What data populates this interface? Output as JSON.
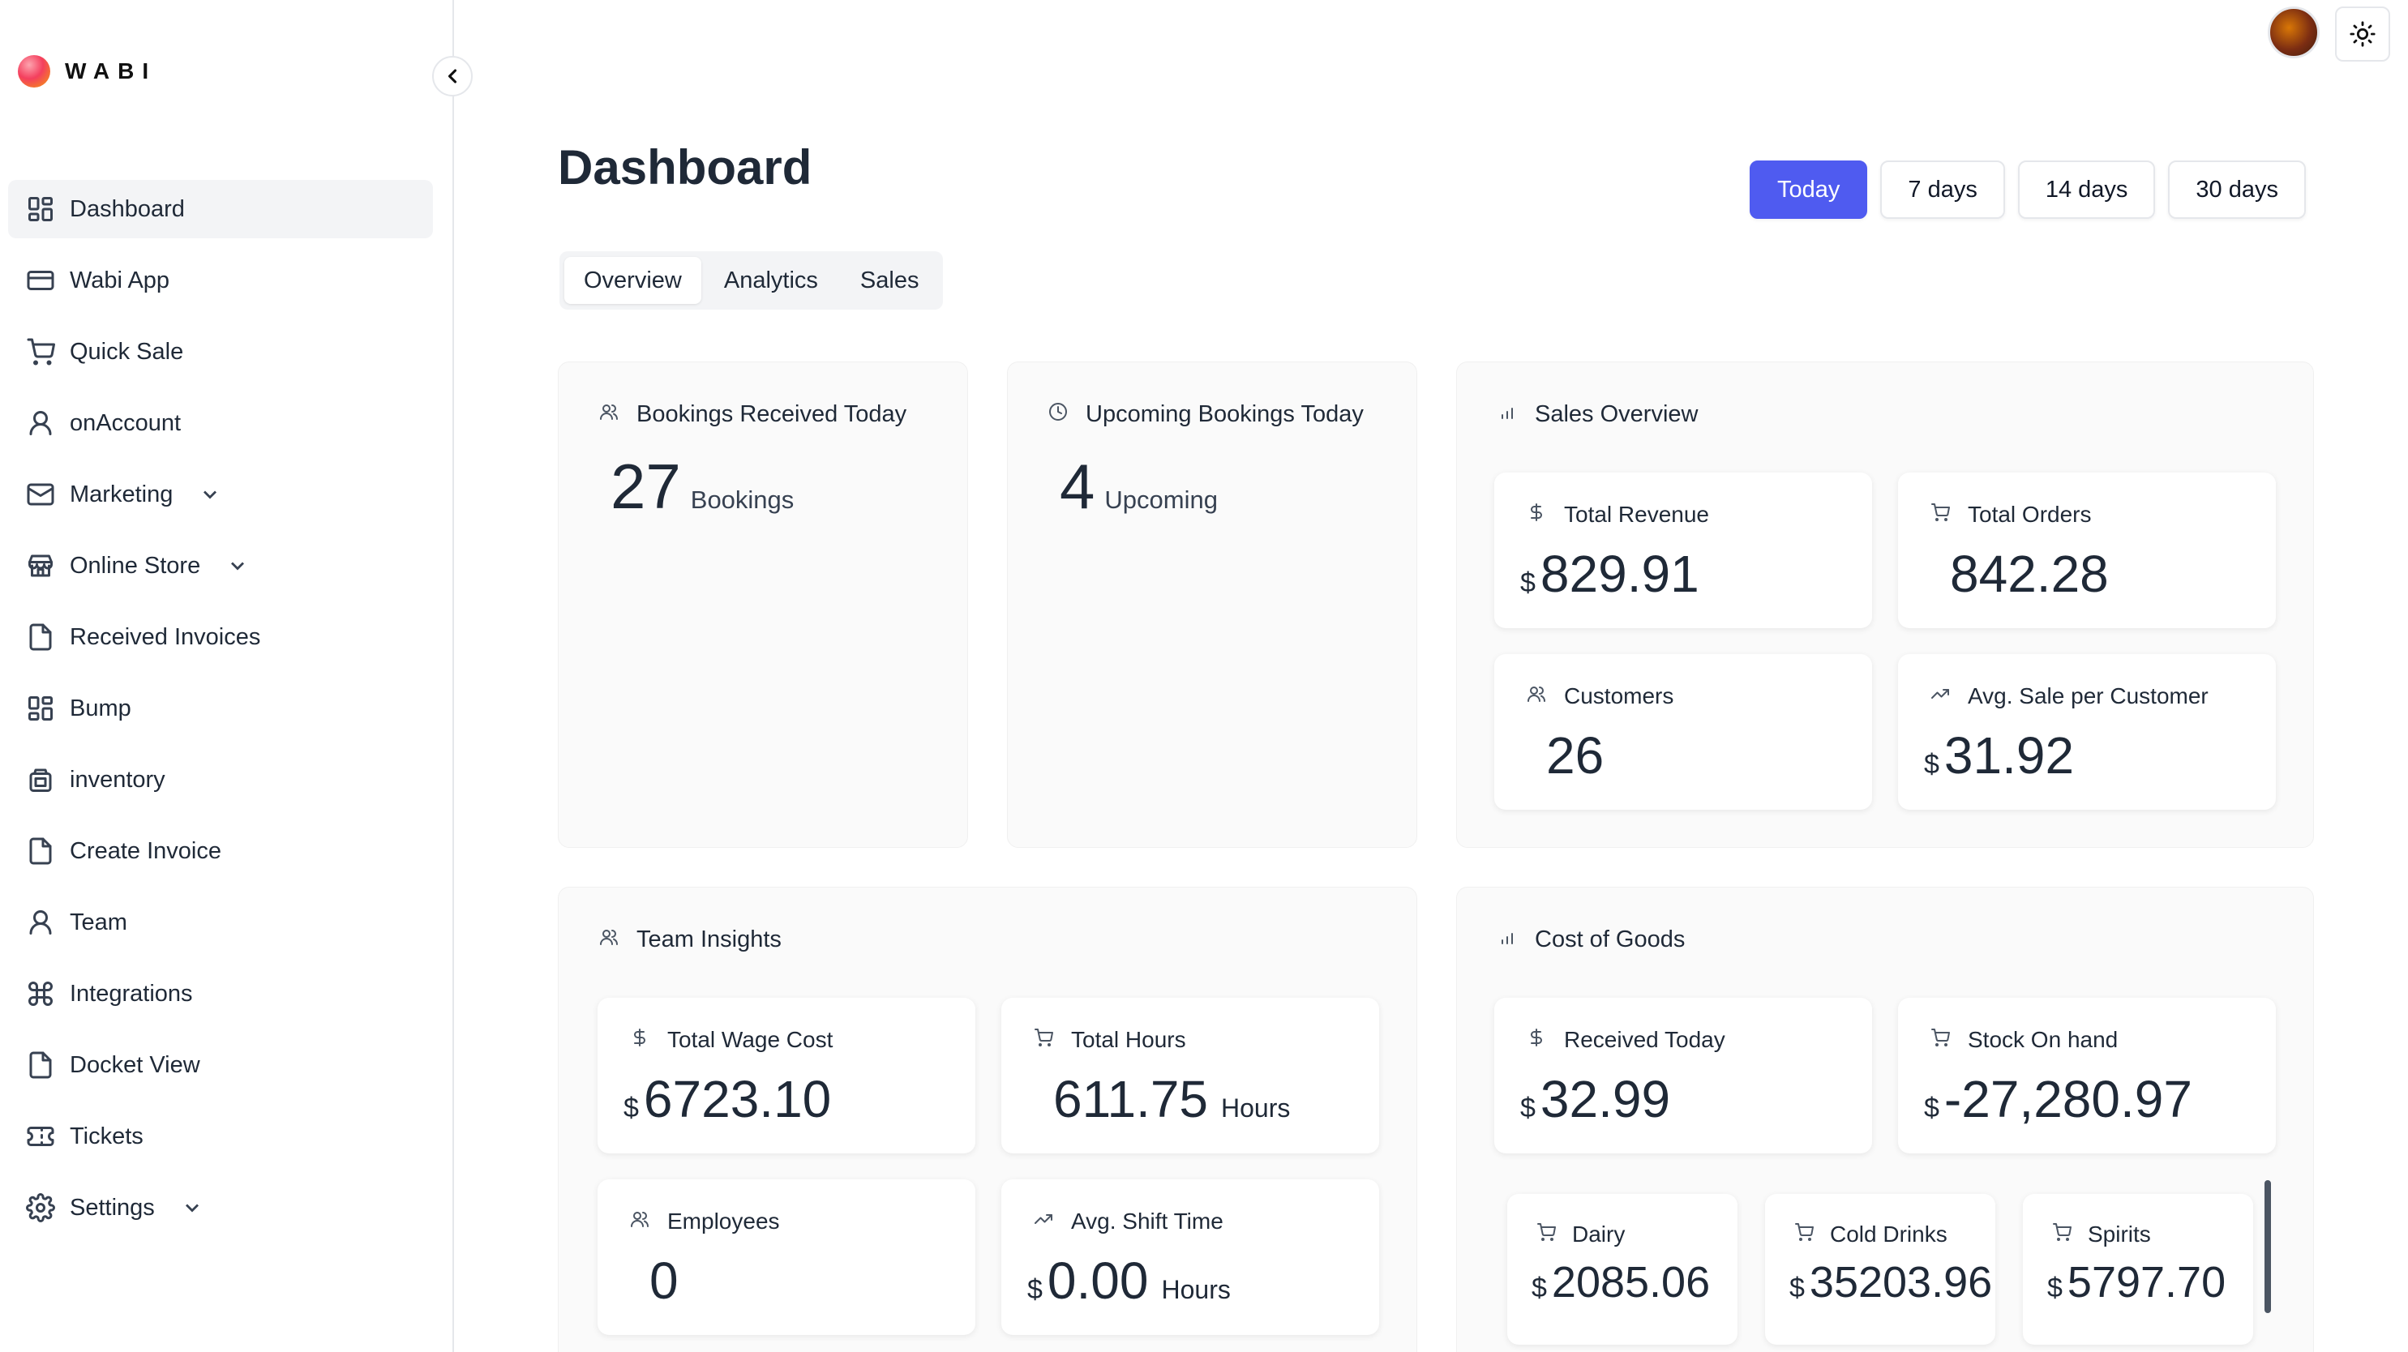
{
  "brand": {
    "name": "WABI"
  },
  "sidebar": {
    "items": [
      {
        "label": "Dashboard",
        "icon": "dashboard-icon",
        "active": true
      },
      {
        "label": "Wabi App",
        "icon": "card-icon"
      },
      {
        "label": "Quick Sale",
        "icon": "cart-icon"
      },
      {
        "label": "onAccount",
        "icon": "user-icon"
      },
      {
        "label": "Marketing",
        "icon": "mail-icon",
        "expandable": true
      },
      {
        "label": "Online Store",
        "icon": "store-icon",
        "expandable": true
      },
      {
        "label": "Received Invoices",
        "icon": "file-icon"
      },
      {
        "label": "Bump",
        "icon": "dashboard-icon"
      },
      {
        "label": "inventory",
        "icon": "package-icon"
      },
      {
        "label": "Create Invoice",
        "icon": "file-icon"
      },
      {
        "label": "Team",
        "icon": "user-icon"
      },
      {
        "label": "Integrations",
        "icon": "command-icon"
      },
      {
        "label": "Docket View",
        "icon": "file-icon"
      },
      {
        "label": "Tickets",
        "icon": "ticket-icon"
      },
      {
        "label": "Settings",
        "icon": "gear-icon",
        "expandable": true
      }
    ]
  },
  "header": {
    "title": "Dashboard",
    "ranges": [
      "Today",
      "7 days",
      "14 days",
      "30 days"
    ],
    "active_range": "Today",
    "tabs": [
      "Overview",
      "Analytics",
      "Sales"
    ],
    "active_tab": "Overview"
  },
  "bookings_received": {
    "title": "Bookings Received Today",
    "value": "27",
    "unit": "Bookings"
  },
  "upcoming_bookings": {
    "title": "Upcoming Bookings Today",
    "value": "4",
    "unit": "Upcoming"
  },
  "sales_overview": {
    "title": "Sales Overview",
    "total_revenue": {
      "title": "Total Revenue",
      "currency": "$",
      "value": "829.91"
    },
    "total_orders": {
      "title": "Total Orders",
      "value": "842.28"
    },
    "customers": {
      "title": "Customers",
      "value": "26"
    },
    "avg_sale": {
      "title": "Avg. Sale per Customer",
      "currency": "$",
      "value": "31.92"
    }
  },
  "team_insights": {
    "title": "Team Insights",
    "total_wage_cost": {
      "title": "Total Wage Cost",
      "currency": "$",
      "value": "6723.10"
    },
    "total_hours": {
      "title": "Total Hours",
      "value": "611.75",
      "unit": "Hours"
    },
    "employees": {
      "title": "Employees",
      "value": "0"
    },
    "avg_shift_time": {
      "title": "Avg. Shift Time",
      "currency": "$",
      "value": "0.00",
      "unit": "Hours"
    }
  },
  "cost_of_goods": {
    "title": "Cost of Goods",
    "received_today": {
      "title": "Received Today",
      "currency": "$",
      "value": "32.99"
    },
    "stock_on_hand": {
      "title": "Stock On hand",
      "currency": "$",
      "value": "-27,280.97"
    },
    "categories": [
      {
        "title": "Dairy",
        "currency": "$",
        "value": "2085.06"
      },
      {
        "title": "Cold Drinks",
        "currency": "$",
        "value": "35203.96"
      },
      {
        "title": "Spirits",
        "currency": "$",
        "value": "5797.70"
      }
    ]
  },
  "colors": {
    "accent": "#4f5bf0",
    "panel_bg": "#fafafa",
    "sidebar_active": "#f3f4f6"
  }
}
